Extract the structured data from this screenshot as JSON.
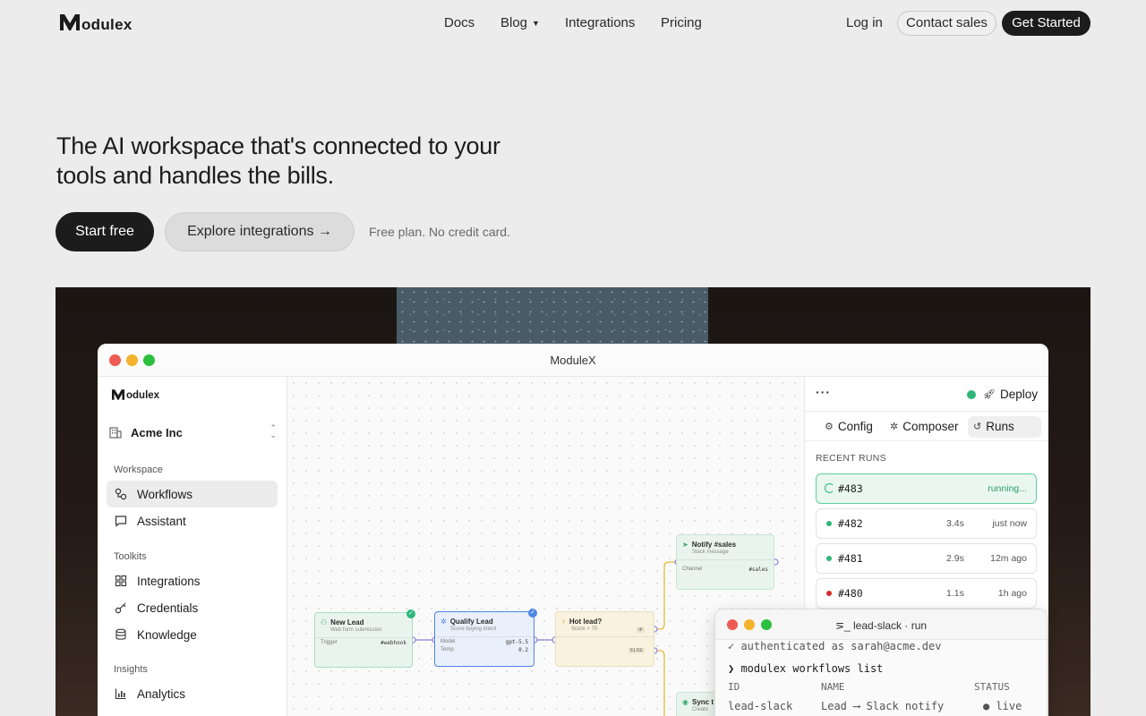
{
  "brand": {
    "name": "odulex",
    "app_name": "odulex"
  },
  "nav": {
    "links": [
      "Docs",
      "Blog",
      "Integrations",
      "Pricing"
    ],
    "login": "Log in",
    "contact": "Contact sales",
    "get_started": "Get Started"
  },
  "hero": {
    "title": "The AI workspace that's connected to your tools and handles the bills.",
    "start": "Start free",
    "explore": "Explore integrations →",
    "note": "Free plan. No credit card."
  },
  "window": {
    "title": "ModuleX"
  },
  "sidebar": {
    "org": "Acme Inc",
    "sections": [
      {
        "title": "Workspace",
        "items": [
          "Workflows",
          "Assistant"
        ]
      },
      {
        "title": "Toolkits",
        "items": [
          "Integrations",
          "Credentials",
          "Knowledge"
        ]
      },
      {
        "title": "Insights",
        "items": [
          "Analytics"
        ]
      }
    ]
  },
  "nodes": {
    "notify": {
      "title": "Notify #sales",
      "sub": "Slack message",
      "k": "Channel",
      "v": "#sales"
    },
    "newlead": {
      "title": "New Lead",
      "sub": "Web form submission",
      "k": "Trigger",
      "v": "#webhook"
    },
    "qualify": {
      "title": "Qualify Lead",
      "sub": "Score buying intent",
      "k1": "Model",
      "v1": "gpt-5.5",
      "k2": "Temp",
      "v2": "0.2"
    },
    "hotlead": {
      "title": "Hot lead?",
      "sub": "Score > 70",
      "if": "IF",
      "else": "ELSE"
    },
    "sync": {
      "title": "Sync t",
      "sub": "Create"
    }
  },
  "panel": {
    "deploy": "Deploy",
    "tabs": [
      "Config",
      "Composer",
      "Runs"
    ],
    "recent_label": "RECENT RUNS",
    "runs": [
      {
        "id": "#483",
        "dur": "",
        "when": "running..."
      },
      {
        "id": "#482",
        "dur": "3.4s",
        "when": "just now"
      },
      {
        "id": "#481",
        "dur": "2.9s",
        "when": "12m ago"
      },
      {
        "id": "#480",
        "dur": "1.1s",
        "when": "1h ago"
      }
    ]
  },
  "terminal": {
    "title": "⋝_ lead-slack · run",
    "line1": "✓ authenticated as sarah@acme.dev",
    "prompt": "❯ modulex workflows list",
    "headers": [
      "ID",
      "NAME",
      "STATUS"
    ],
    "row": [
      "lead-slack",
      "Lead ⟶ Slack notify",
      "● live"
    ]
  },
  "colors": {
    "accent_green": "#2fb77a",
    "dark": "#1c1c1c",
    "purple_port": "#8b7fd9",
    "orange_edge": "#e8b93a"
  }
}
